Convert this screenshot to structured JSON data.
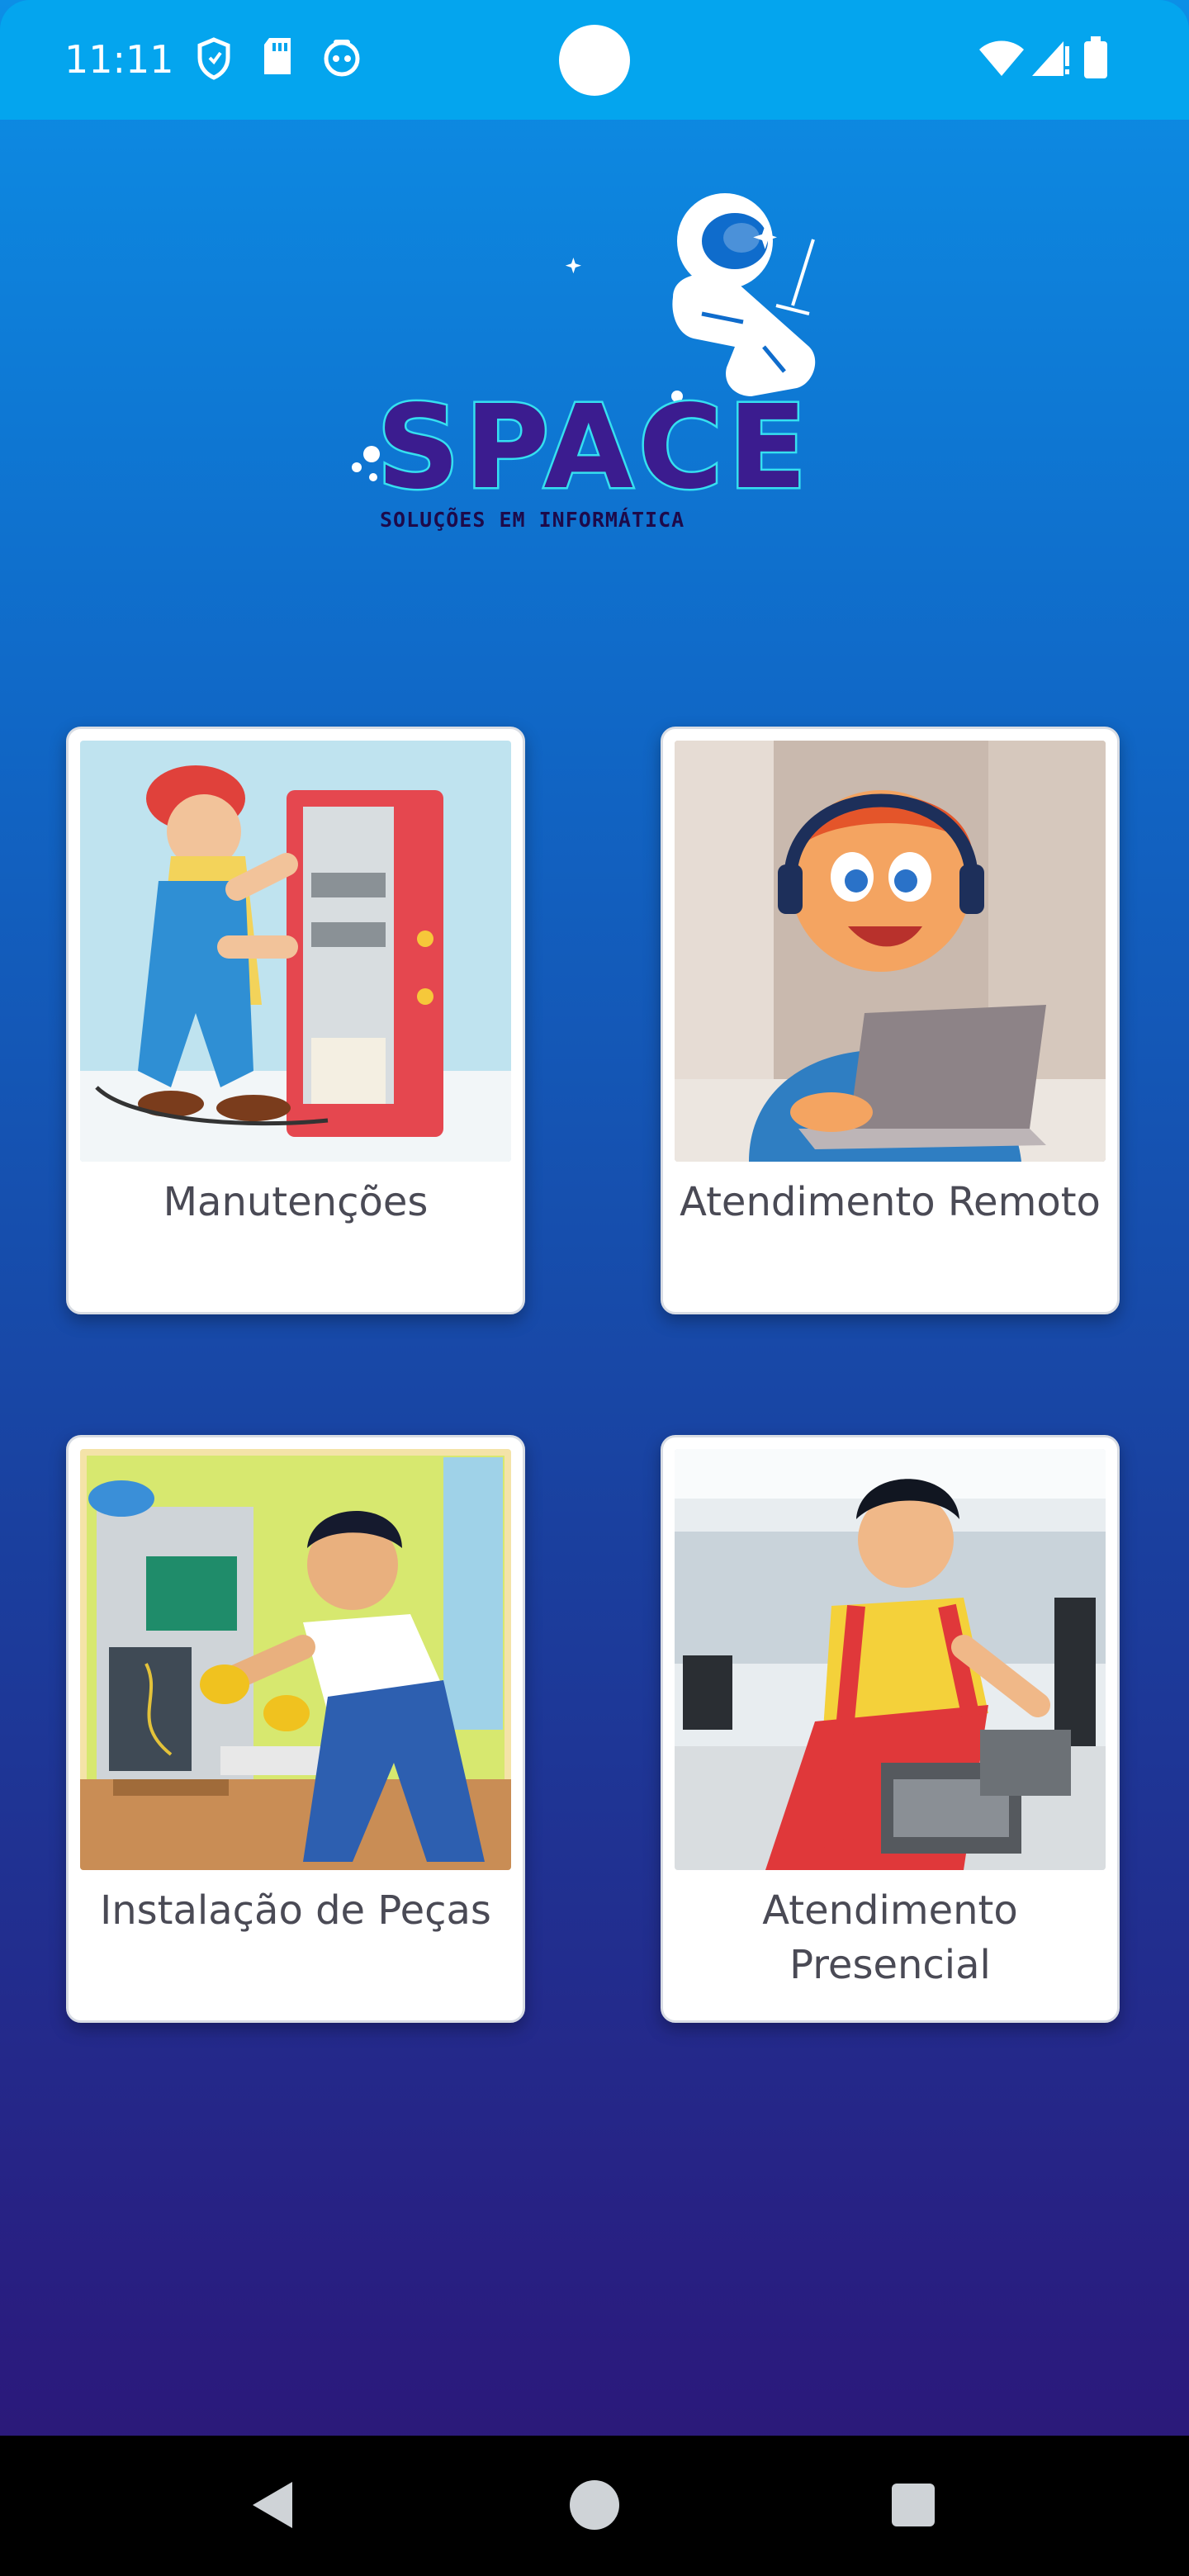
{
  "status_bar": {
    "time": "11:11",
    "icons": [
      "shield-icon",
      "sd-card-icon",
      "robot-face-icon",
      "wifi-icon",
      "signal-icon",
      "battery-icon"
    ]
  },
  "logo": {
    "brand": "SPACE",
    "tagline": "SOLUÇÕES EM INFORMÁTICA"
  },
  "services": [
    {
      "label": "Manutenções",
      "illustration": "technician-repairing-computer"
    },
    {
      "label": "Atendimento Remoto",
      "illustration": "support-agent-with-headset-laptop"
    },
    {
      "label": "Instalação de Peças",
      "illustration": "technician-installing-parts"
    },
    {
      "label": "Atendimento Presencial",
      "label_line1": "Atendimento",
      "label_line2": "Presencial",
      "illustration": "technician-onsite-server"
    }
  ],
  "nav": {
    "buttons": [
      "back-icon",
      "home-icon",
      "recents-icon"
    ]
  },
  "colors": {
    "status_bar": "#04a5ee",
    "gradient_top": "#0c8fe6",
    "gradient_bottom": "#2d1670",
    "card_bg": "#ffffff",
    "label_text": "#4a4a55",
    "logo_brand": "#3b1c8f",
    "logo_outline": "#35e0f0"
  }
}
